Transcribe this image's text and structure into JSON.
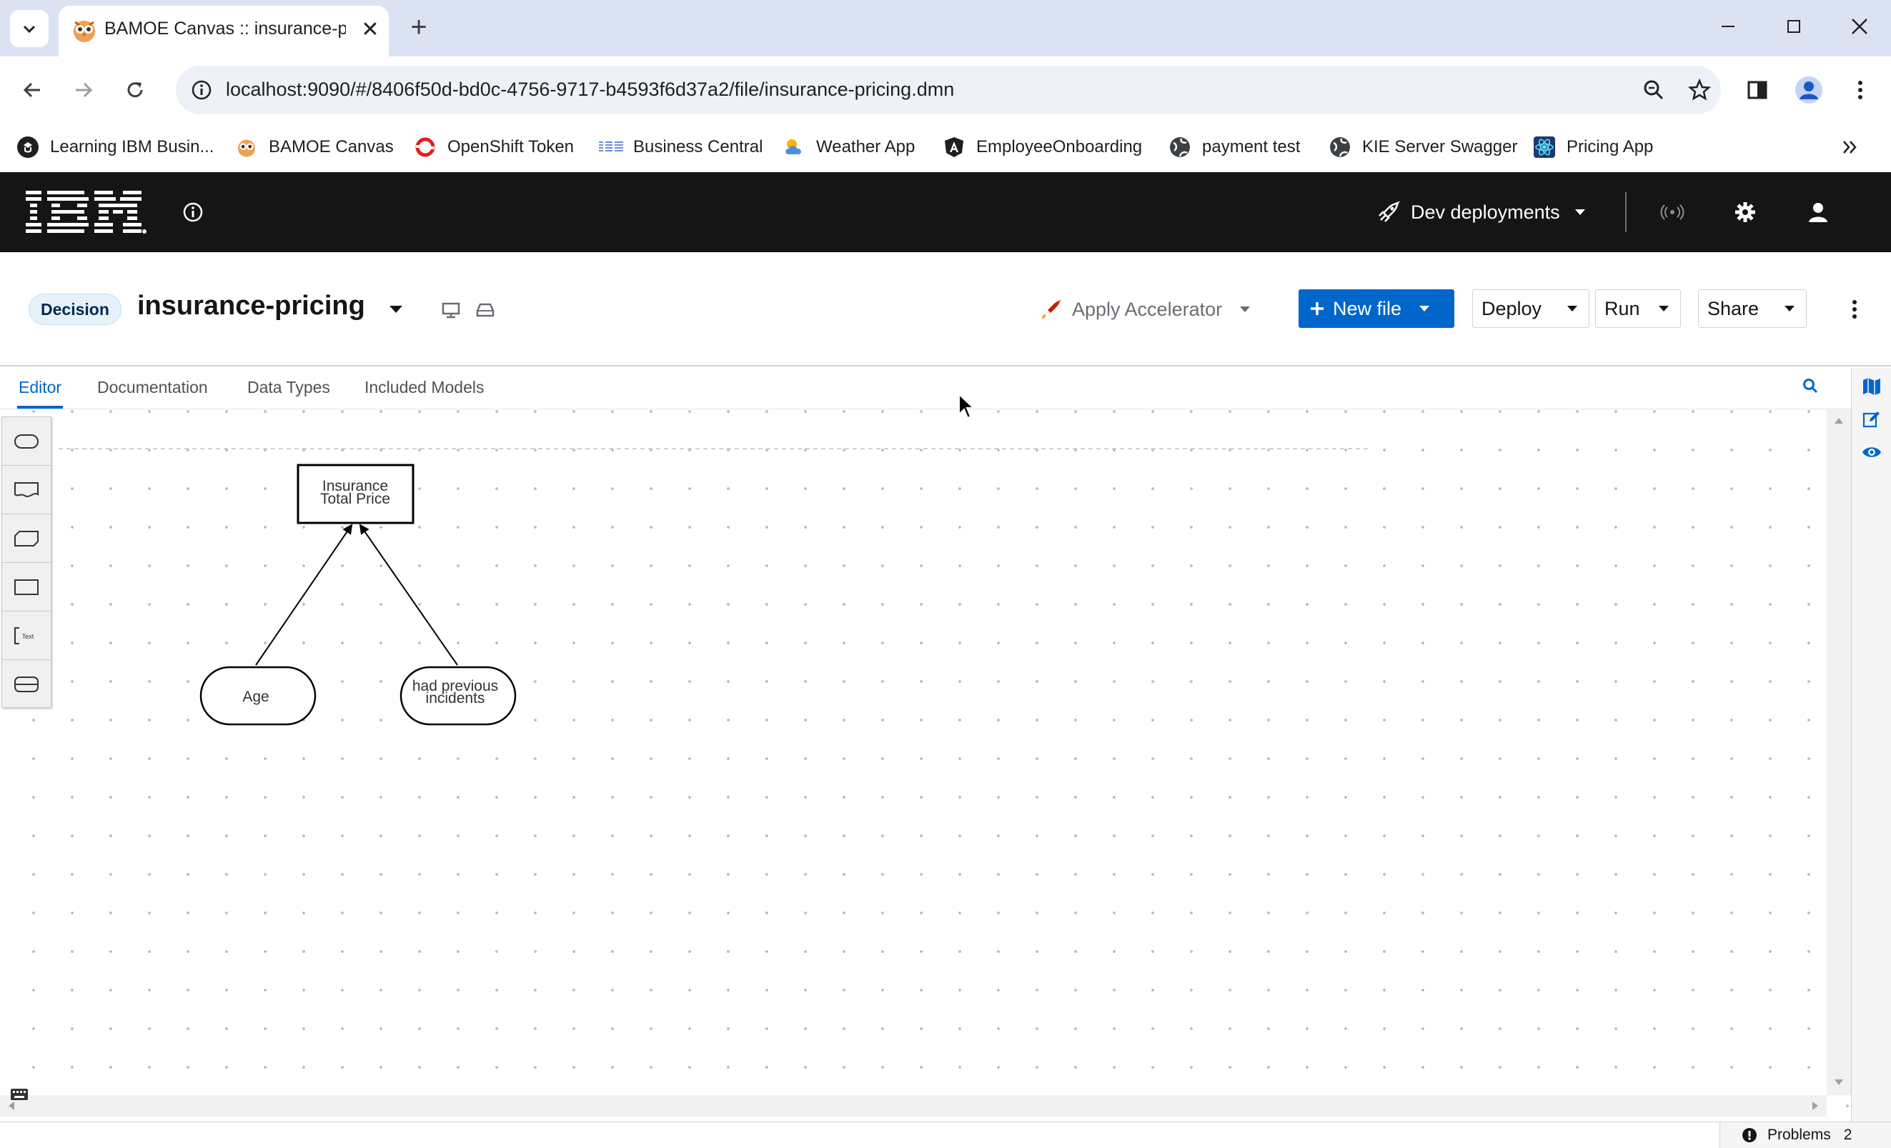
{
  "browser": {
    "tab_title": "BAMOE Canvas :: insurance-pric",
    "url": "localhost:9090/#/8406f50d-bd0c-4756-9717-b4593f6d37a2/file/insurance-pricing.dmn",
    "bookmarks_more_icon": "double-chevron-right-icon",
    "bookmarks": [
      {
        "label": "Learning IBM Busin...",
        "icon": "learning-icon"
      },
      {
        "label": "BAMOE Canvas",
        "icon": "bamoe-owl-icon"
      },
      {
        "label": "OpenShift Token",
        "icon": "openshift-icon"
      },
      {
        "label": "Business Central",
        "icon": "ibm-icon"
      },
      {
        "label": "Weather App",
        "icon": "weather-icon"
      },
      {
        "label": "EmployeeOnboarding",
        "icon": "angular-icon"
      },
      {
        "label": "payment test",
        "icon": "globe-icon"
      },
      {
        "label": "KIE Server Swagger",
        "icon": "globe-icon"
      },
      {
        "label": "Pricing App",
        "icon": "react-icon"
      }
    ]
  },
  "masthead": {
    "brand": "IBM",
    "deployments_label": "Dev deployments"
  },
  "file": {
    "badge": "Decision",
    "name": "insurance-pricing",
    "apply_accelerator": "Apply Accelerator",
    "new_file": "New file",
    "deploy": "Deploy",
    "run": "Run",
    "share": "Share"
  },
  "editor": {
    "tabs": [
      "Editor",
      "Documentation",
      "Data Types",
      "Included Models"
    ],
    "active_tab": "Editor"
  },
  "diagram": {
    "nodes": [
      {
        "type": "decision",
        "label_lines": [
          "Insurance",
          "Total Price"
        ]
      },
      {
        "type": "input-data",
        "label_lines": [
          "Age"
        ]
      },
      {
        "type": "input-data",
        "label_lines": [
          "had previous",
          "incidents"
        ]
      }
    ],
    "edges": [
      {
        "from": "Age",
        "to": "Insurance Total Price"
      },
      {
        "from": "had previous incidents",
        "to": "Insurance Total Price"
      }
    ]
  },
  "status": {
    "problems_label": "Problems",
    "problems_count": "2"
  },
  "colors": {
    "accent": "#0066cc",
    "masthead": "#151515",
    "tabstrip": "#dbe3f3"
  }
}
